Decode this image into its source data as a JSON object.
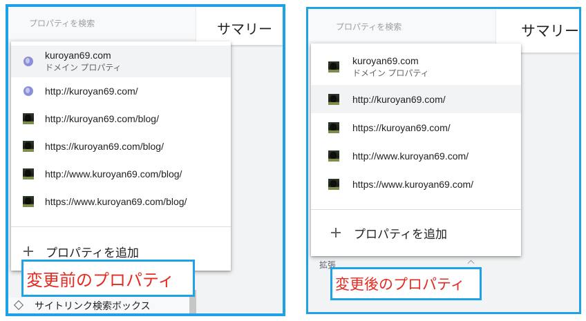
{
  "left": {
    "search_placeholder": "プロパティを検索",
    "summary_tab": "サマリー",
    "items": [
      {
        "label": "kuroyan69.com",
        "sub": "ドメイン プロパティ",
        "icon": "globe-icon"
      },
      {
        "label": "http://kuroyan69.com/",
        "icon": "globe-icon"
      },
      {
        "label": "http://kuroyan69.com/blog/",
        "icon": "cat-avatar-icon"
      },
      {
        "label": "https://kuroyan69.com/blog/",
        "icon": "cat-avatar-icon"
      },
      {
        "label": "http://www.kuroyan69.com/blog/",
        "icon": "cat-avatar-icon"
      },
      {
        "label": "https://www.kuroyan69.com/blog/",
        "icon": "cat-avatar-icon"
      }
    ],
    "add_property": "プロパティを追加",
    "caption": "変更前のプロパティ",
    "bottom_item": "サイトリンク検索ボックス"
  },
  "right": {
    "search_placeholder": "プロパティを検索",
    "summary_tab": "サマリー",
    "items": [
      {
        "label": "kuroyan69.com",
        "sub": "ドメイン プロパティ",
        "icon": "cat-avatar-icon"
      },
      {
        "label": "http://kuroyan69.com/",
        "icon": "cat-avatar-icon"
      },
      {
        "label": "https://kuroyan69.com/",
        "icon": "cat-avatar-icon"
      },
      {
        "label": "http://www.kuroyan69.com/",
        "icon": "cat-avatar-icon"
      },
      {
        "label": "https://www.kuroyan69.com/",
        "icon": "cat-avatar-icon"
      }
    ],
    "add_property": "プロパティを追加",
    "caption": "変更後のプロパティ",
    "section_label": "拡張"
  },
  "colors": {
    "frame": "#1ea1e6",
    "caption_text": "#e52b21",
    "selected_row": "#f1f3f4"
  }
}
